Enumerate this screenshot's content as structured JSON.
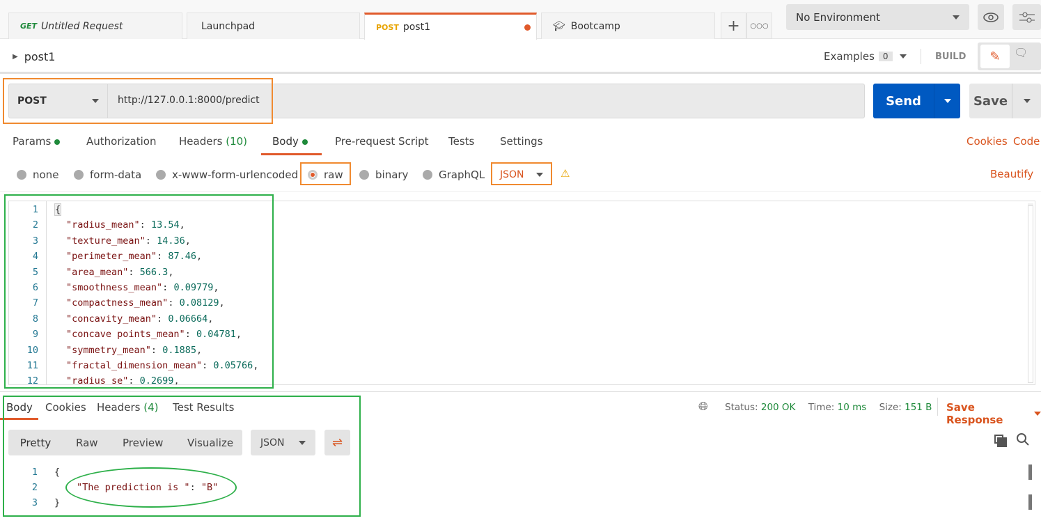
{
  "tabs": [
    {
      "method": "GET",
      "label": "Untitled Request"
    },
    {
      "label": "Launchpad"
    },
    {
      "method": "POST",
      "label": "post1",
      "unsaved": true
    },
    {
      "label": "Bootcamp",
      "icon": "graduation-cap-icon"
    }
  ],
  "environment": {
    "selected": "No Environment"
  },
  "request": {
    "name": "post1",
    "examples_label": "Examples",
    "examples_count": "0",
    "build_label": "BUILD",
    "method": "POST",
    "url": "http://127.0.0.1:8000/predict",
    "send_label": "Send",
    "save_label": "Save"
  },
  "request_tabs": [
    {
      "label": "Params",
      "dot": true
    },
    {
      "label": "Authorization"
    },
    {
      "label": "Headers",
      "count": "(10)"
    },
    {
      "label": "Body",
      "dot": true,
      "active": true
    },
    {
      "label": "Pre-request Script"
    },
    {
      "label": "Tests"
    },
    {
      "label": "Settings"
    }
  ],
  "request_links": {
    "cookies": "Cookies",
    "code": "Code",
    "beautify": "Beautify"
  },
  "body_types": [
    "none",
    "form-data",
    "x-www-form-urlencoded",
    "raw",
    "binary",
    "GraphQL"
  ],
  "body_selected": "raw",
  "body_format": "JSON",
  "body_lines": [
    {
      "n": "1",
      "t": "{"
    },
    {
      "n": "2",
      "k": "\"radius_mean\"",
      "v": "13.54"
    },
    {
      "n": "3",
      "k": "\"texture_mean\"",
      "v": "14.36"
    },
    {
      "n": "4",
      "k": "\"perimeter_mean\"",
      "v": "87.46"
    },
    {
      "n": "5",
      "k": "\"area_mean\"",
      "v": "566.3"
    },
    {
      "n": "6",
      "k": "\"smoothness_mean\"",
      "v": "0.09779"
    },
    {
      "n": "7",
      "k": "\"compactness_mean\"",
      "v": "0.08129"
    },
    {
      "n": "8",
      "k": "\"concavity_mean\"",
      "v": "0.06664"
    },
    {
      "n": "9",
      "k": "\"concave points_mean\"",
      "v": "0.04781"
    },
    {
      "n": "10",
      "k": "\"symmetry_mean\"",
      "v": "0.1885"
    },
    {
      "n": "11",
      "k": "\"fractal_dimension_mean\"",
      "v": "0.05766"
    },
    {
      "n": "12",
      "k": "\"radius_se\"",
      "v": "0.2699"
    }
  ],
  "response": {
    "tabs": [
      {
        "label": "Body",
        "active": true
      },
      {
        "label": "Cookies"
      },
      {
        "label": "Headers",
        "count": "(4)"
      },
      {
        "label": "Test Results"
      }
    ],
    "status_label": "Status:",
    "status": "200 OK",
    "time_label": "Time:",
    "time": "10 ms",
    "size_label": "Size:",
    "size": "151 B",
    "save_label": "Save Response",
    "views": [
      "Pretty",
      "Raw",
      "Preview",
      "Visualize"
    ],
    "format": "JSON",
    "lines": [
      {
        "n": "1",
        "t": "{"
      },
      {
        "n": "2",
        "k": "\"The prediction is \"",
        "v": "\"B\""
      },
      {
        "n": "3",
        "t": "}"
      }
    ]
  },
  "colors": {
    "accent": "#e05a2b",
    "send": "#0059c1",
    "ok": "#1f8a3b"
  }
}
